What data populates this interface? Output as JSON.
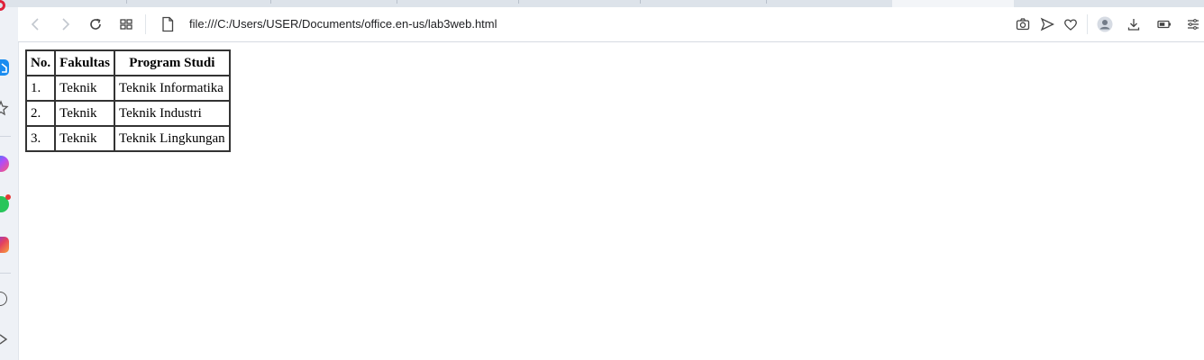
{
  "browser": {
    "url": "file:///C:/Users/USER/Documents/office.en-us/lab3web.html",
    "toolbar_icons": [
      "back-icon",
      "forward-icon",
      "reload-icon",
      "tab-grid-icon",
      "page-info-icon",
      "camera-icon",
      "send-icon",
      "heart-icon",
      "profile-icon",
      "download-icon",
      "battery-icon",
      "easy-setup-icon"
    ],
    "sidebar_icons": [
      "home-icon",
      "star-icon",
      "messenger-icon",
      "whatsapp-icon",
      "instagram-icon",
      "player-icon",
      "more-icon"
    ]
  },
  "page": {
    "table": {
      "headers": [
        "No.",
        "Fakultas",
        "Program Studi"
      ],
      "rows": [
        [
          "1.",
          "Teknik",
          "Teknik Informatika"
        ],
        [
          "2.",
          "Teknik",
          "Teknik Industri"
        ],
        [
          "3.",
          "Teknik",
          "Teknik Lingkungan"
        ]
      ]
    }
  },
  "colors": {
    "sidebar": "#eef1f6",
    "accent_blue": "#1a8cf0",
    "border": "#333333"
  }
}
